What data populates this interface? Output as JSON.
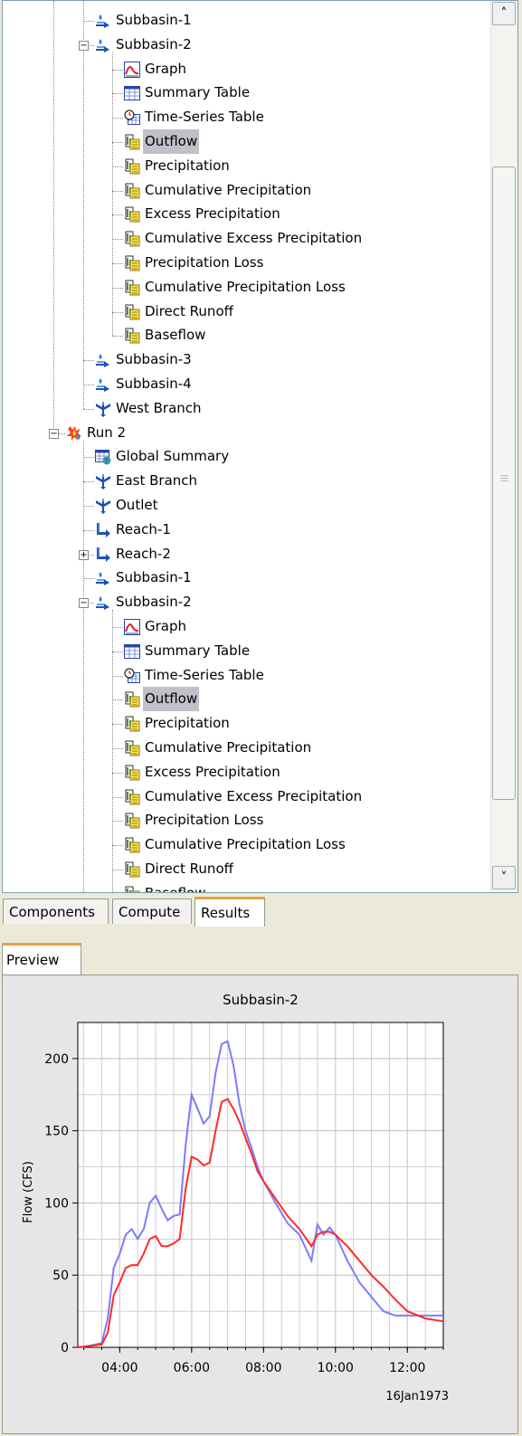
{
  "tree": {
    "rows": [
      {
        "label": "Subbasin-1",
        "icon": "subbasin-icon",
        "level": 2
      },
      {
        "label": "Subbasin-2",
        "icon": "subbasin-icon",
        "level": 2,
        "expander": "minus"
      },
      {
        "label": "Graph",
        "icon": "graph-icon",
        "level": 3
      },
      {
        "label": "Summary Table",
        "icon": "summary-table-icon",
        "level": 3
      },
      {
        "label": "Time-Series Table",
        "icon": "time-series-table-icon",
        "level": 3
      },
      {
        "label": "Outflow",
        "icon": "result-icon",
        "level": 3,
        "selected": true
      },
      {
        "label": "Precipitation",
        "icon": "result-icon",
        "level": 3
      },
      {
        "label": "Cumulative Precipitation",
        "icon": "result-icon",
        "level": 3
      },
      {
        "label": "Excess Precipitation",
        "icon": "result-icon",
        "level": 3
      },
      {
        "label": "Cumulative Excess Precipitation",
        "icon": "result-icon",
        "level": 3
      },
      {
        "label": "Precipitation Loss",
        "icon": "result-icon",
        "level": 3
      },
      {
        "label": "Cumulative Precipitation Loss",
        "icon": "result-icon",
        "level": 3
      },
      {
        "label": "Direct Runoff",
        "icon": "result-icon",
        "level": 3
      },
      {
        "label": "Baseflow",
        "icon": "result-icon",
        "level": 3
      },
      {
        "label": "Subbasin-3",
        "icon": "subbasin-icon",
        "level": 2
      },
      {
        "label": "Subbasin-4",
        "icon": "subbasin-icon",
        "level": 2
      },
      {
        "label": "West Branch",
        "icon": "junction-icon",
        "level": 2
      },
      {
        "label": "Run 2",
        "icon": "run-icon",
        "level": 1,
        "expander": "minus"
      },
      {
        "label": "Global Summary",
        "icon": "global-summary-icon",
        "level": 2
      },
      {
        "label": "East Branch",
        "icon": "junction-icon",
        "level": 2
      },
      {
        "label": "Outlet",
        "icon": "junction-icon",
        "level": 2
      },
      {
        "label": "Reach-1",
        "icon": "reach-icon",
        "level": 2
      },
      {
        "label": "Reach-2",
        "icon": "reach-icon",
        "level": 2,
        "expander": "plus"
      },
      {
        "label": "Subbasin-1",
        "icon": "subbasin-icon",
        "level": 2
      },
      {
        "label": "Subbasin-2",
        "icon": "subbasin-icon",
        "level": 2,
        "expander": "minus"
      },
      {
        "label": "Graph",
        "icon": "graph-icon",
        "level": 3
      },
      {
        "label": "Summary Table",
        "icon": "summary-table-icon",
        "level": 3
      },
      {
        "label": "Time-Series Table",
        "icon": "time-series-table-icon",
        "level": 3
      },
      {
        "label": "Outflow",
        "icon": "result-icon",
        "level": 3,
        "selected": true
      },
      {
        "label": "Precipitation",
        "icon": "result-icon",
        "level": 3
      },
      {
        "label": "Cumulative Precipitation",
        "icon": "result-icon",
        "level": 3
      },
      {
        "label": "Excess Precipitation",
        "icon": "result-icon",
        "level": 3
      },
      {
        "label": "Cumulative Excess Precipitation",
        "icon": "result-icon",
        "level": 3
      },
      {
        "label": "Precipitation Loss",
        "icon": "result-icon",
        "level": 3
      },
      {
        "label": "Cumulative Precipitation Loss",
        "icon": "result-icon",
        "level": 3
      },
      {
        "label": "Direct Runoff",
        "icon": "result-icon",
        "level": 3
      },
      {
        "label": "Baseflow",
        "icon": "result-icon",
        "level": 3
      }
    ]
  },
  "tabs": {
    "components": "Components",
    "compute": "Compute",
    "results": "Results",
    "active": "results"
  },
  "preview": {
    "tab_label": "Preview"
  },
  "colors": {
    "accent": "#e8a33d",
    "selection": "#c0c0c8",
    "series_blue": "#7b7bff",
    "series_red": "#ff2a2a"
  },
  "chart_data": {
    "type": "line",
    "title": "Subbasin-2",
    "xlabel": "",
    "ylabel": "Flow (CFS)",
    "date_label": "16Jan1973",
    "xlim": [
      "02:50",
      "13:00"
    ],
    "ylim": [
      0,
      225
    ],
    "x_ticks": [
      "04:00",
      "06:00",
      "08:00",
      "10:00",
      "12:00"
    ],
    "y_ticks": [
      0,
      50,
      100,
      150,
      200
    ],
    "grid": true,
    "series": [
      {
        "color": "#7b7bff",
        "x": [
          "02:50",
          "03:10",
          "03:30",
          "03:40",
          "03:50",
          "04:00",
          "04:10",
          "04:20",
          "04:30",
          "04:40",
          "04:50",
          "05:00",
          "05:10",
          "05:20",
          "05:30",
          "05:40",
          "05:50",
          "06:00",
          "06:10",
          "06:20",
          "06:30",
          "06:40",
          "06:50",
          "07:00",
          "07:10",
          "07:20",
          "07:30",
          "07:40",
          "07:50",
          "08:00",
          "08:20",
          "08:40",
          "09:00",
          "09:20",
          "09:30",
          "09:40",
          "09:50",
          "10:00",
          "10:20",
          "10:40",
          "11:00",
          "11:20",
          "11:40",
          "12:00",
          "12:30",
          "13:00"
        ],
        "y": [
          0,
          1,
          3,
          20,
          55,
          65,
          78,
          82,
          75,
          82,
          100,
          105,
          96,
          88,
          91,
          92,
          140,
          175,
          165,
          155,
          160,
          190,
          210,
          212,
          195,
          168,
          150,
          138,
          125,
          115,
          100,
          86,
          78,
          60,
          85,
          78,
          83,
          78,
          60,
          45,
          35,
          25,
          22,
          22,
          22,
          22
        ]
      },
      {
        "color": "#ff2a2a",
        "x": [
          "02:50",
          "03:10",
          "03:30",
          "03:40",
          "03:50",
          "04:00",
          "04:10",
          "04:20",
          "04:30",
          "04:40",
          "04:50",
          "05:00",
          "05:10",
          "05:20",
          "05:30",
          "05:40",
          "05:50",
          "06:00",
          "06:10",
          "06:20",
          "06:30",
          "06:40",
          "06:50",
          "07:00",
          "07:10",
          "07:20",
          "07:30",
          "07:40",
          "07:50",
          "08:00",
          "08:20",
          "08:40",
          "09:00",
          "09:20",
          "09:30",
          "09:40",
          "09:50",
          "10:00",
          "10:20",
          "10:40",
          "11:00",
          "11:20",
          "11:40",
          "12:00",
          "12:30",
          "13:00"
        ],
        "y": [
          0,
          1,
          2,
          10,
          36,
          45,
          55,
          57,
          57,
          65,
          75,
          77,
          70,
          70,
          72,
          75,
          110,
          132,
          130,
          126,
          128,
          150,
          170,
          172,
          165,
          156,
          145,
          134,
          122,
          115,
          103,
          91,
          82,
          70,
          78,
          80,
          80,
          78,
          70,
          60,
          50,
          42,
          33,
          25,
          20,
          18
        ]
      }
    ]
  }
}
